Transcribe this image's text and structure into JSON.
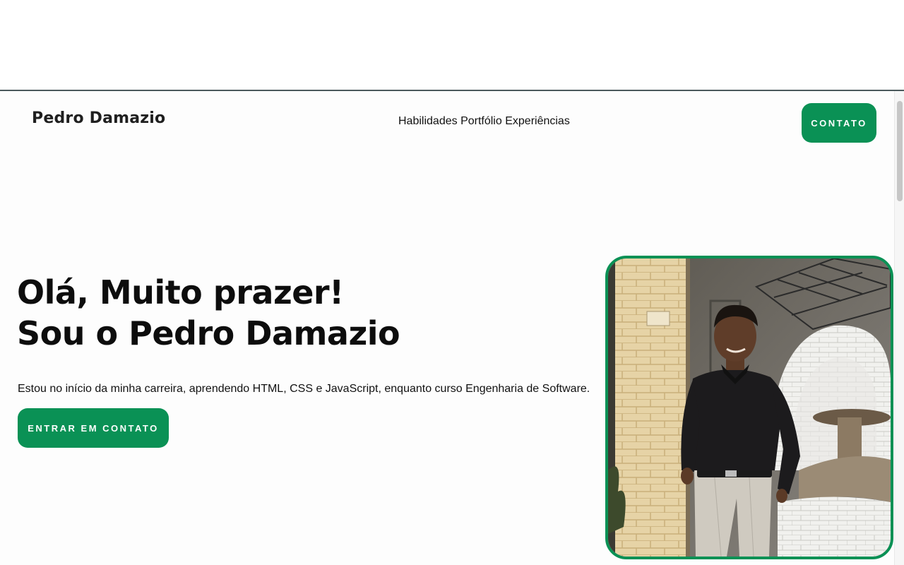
{
  "brand": "Pedro Damazio",
  "nav": {
    "items": [
      "Habilidades",
      "Portfólio",
      "Experiências"
    ],
    "contact_button": "CONTATO"
  },
  "hero": {
    "title_line1": "Olá, Muito prazer!",
    "title_line2": "Sou o Pedro Damazio",
    "description": "Estou no início da minha carreira, aprendendo HTML, CSS e JavaScript, enquanto curso Engenharia de Software.",
    "cta_button": "ENTRAR EM CONTATO"
  },
  "colors": {
    "accent": "#0a9155",
    "text": "#0d0d0d",
    "background": "#fdfdfd"
  }
}
